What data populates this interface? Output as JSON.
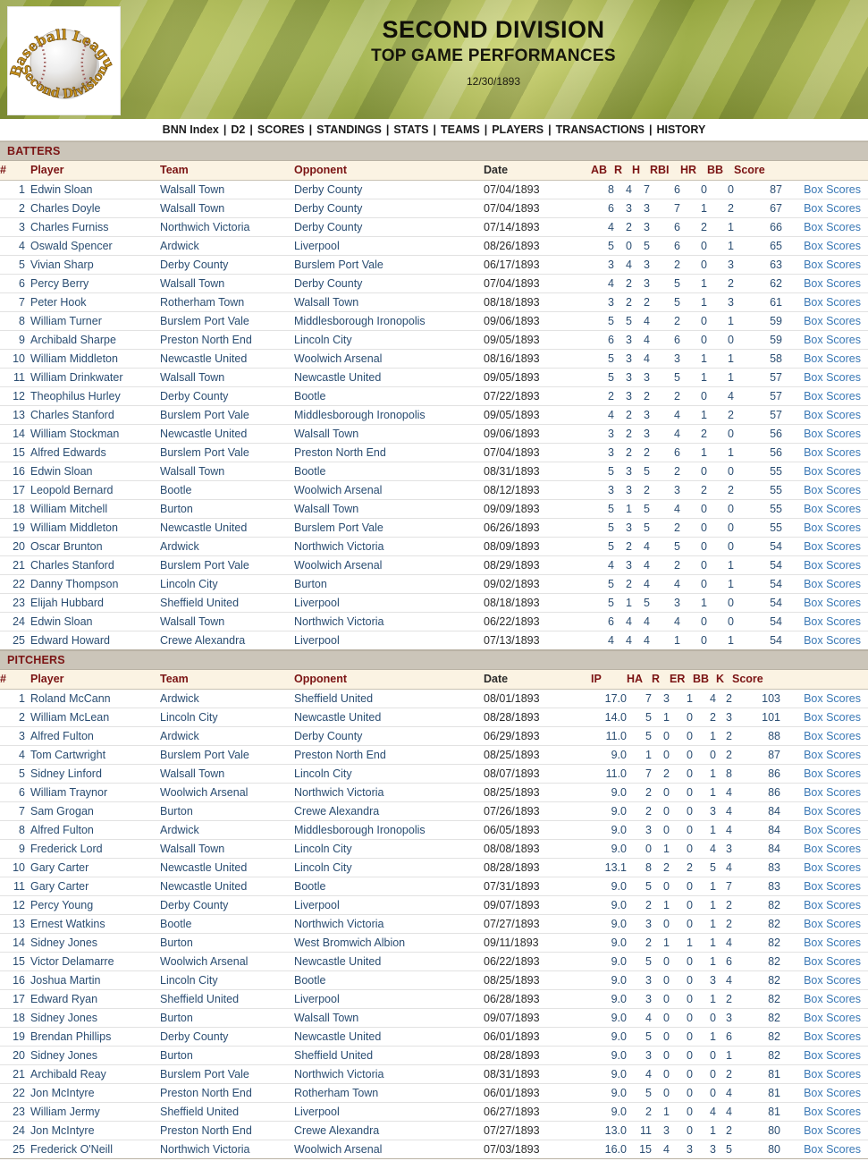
{
  "header": {
    "logo": {
      "top_text": "Baseball League",
      "bottom_text": "Second Division",
      "icon": "baseball-icon"
    },
    "title_main": "SECOND DIVISION",
    "title_sub": "TOP GAME PERFORMANCES",
    "date": "12/30/1893"
  },
  "nav": {
    "separator": "|",
    "items": [
      "BNN Index",
      "D2",
      "SCORES",
      "STANDINGS",
      "STATS",
      "TEAMS",
      "PLAYERS",
      "TRANSACTIONS",
      "HISTORY"
    ]
  },
  "colors": {
    "section_header_bg": "#cbc5b9",
    "section_header_text": "#7b1414",
    "column_header_bg": "#fbf3e3",
    "link": "#2a4d72",
    "box_link": "#3a78b5",
    "banner_green": "#a9b84a"
  },
  "batters": {
    "section_label": "BATTERS",
    "columns": [
      "#",
      "Player",
      "Team",
      "Opponent",
      "Date",
      "AB",
      "R",
      "H",
      "RBI",
      "HR",
      "BB",
      "Score",
      ""
    ],
    "box_label": "Box Scores",
    "rows": [
      {
        "rank": "1",
        "player": "Edwin Sloan",
        "team": "Walsall Town",
        "opponent": "Derby County",
        "date": "07/04/1893",
        "ab": "8",
        "r": "4",
        "h": "7",
        "rbi": "6",
        "hr": "0",
        "bb": "0",
        "score": "87"
      },
      {
        "rank": "2",
        "player": "Charles Doyle",
        "team": "Walsall Town",
        "opponent": "Derby County",
        "date": "07/04/1893",
        "ab": "6",
        "r": "3",
        "h": "3",
        "rbi": "7",
        "hr": "1",
        "bb": "2",
        "score": "67"
      },
      {
        "rank": "3",
        "player": "Charles Furniss",
        "team": "Northwich Victoria",
        "opponent": "Derby County",
        "date": "07/14/1893",
        "ab": "4",
        "r": "2",
        "h": "3",
        "rbi": "6",
        "hr": "2",
        "bb": "1",
        "score": "66"
      },
      {
        "rank": "4",
        "player": "Oswald Spencer",
        "team": "Ardwick",
        "opponent": "Liverpool",
        "date": "08/26/1893",
        "ab": "5",
        "r": "0",
        "h": "5",
        "rbi": "6",
        "hr": "0",
        "bb": "1",
        "score": "65"
      },
      {
        "rank": "5",
        "player": "Vivian Sharp",
        "team": "Derby County",
        "opponent": "Burslem Port Vale",
        "date": "06/17/1893",
        "ab": "3",
        "r": "4",
        "h": "3",
        "rbi": "2",
        "hr": "0",
        "bb": "3",
        "score": "63"
      },
      {
        "rank": "6",
        "player": "Percy Berry",
        "team": "Walsall Town",
        "opponent": "Derby County",
        "date": "07/04/1893",
        "ab": "4",
        "r": "2",
        "h": "3",
        "rbi": "5",
        "hr": "1",
        "bb": "2",
        "score": "62"
      },
      {
        "rank": "7",
        "player": "Peter Hook",
        "team": "Rotherham Town",
        "opponent": "Walsall Town",
        "date": "08/18/1893",
        "ab": "3",
        "r": "2",
        "h": "2",
        "rbi": "5",
        "hr": "1",
        "bb": "3",
        "score": "61"
      },
      {
        "rank": "8",
        "player": "William Turner",
        "team": "Burslem Port Vale",
        "opponent": "Middlesborough Ironopolis",
        "date": "09/06/1893",
        "ab": "5",
        "r": "5",
        "h": "4",
        "rbi": "2",
        "hr": "0",
        "bb": "1",
        "score": "59"
      },
      {
        "rank": "9",
        "player": "Archibald Sharpe",
        "team": "Preston North End",
        "opponent": "Lincoln City",
        "date": "09/05/1893",
        "ab": "6",
        "r": "3",
        "h": "4",
        "rbi": "6",
        "hr": "0",
        "bb": "0",
        "score": "59"
      },
      {
        "rank": "10",
        "player": "William Middleton",
        "team": "Newcastle United",
        "opponent": "Woolwich Arsenal",
        "date": "08/16/1893",
        "ab": "5",
        "r": "3",
        "h": "4",
        "rbi": "3",
        "hr": "1",
        "bb": "1",
        "score": "58"
      },
      {
        "rank": "11",
        "player": "William Drinkwater",
        "team": "Walsall Town",
        "opponent": "Newcastle United",
        "date": "09/05/1893",
        "ab": "5",
        "r": "3",
        "h": "3",
        "rbi": "5",
        "hr": "1",
        "bb": "1",
        "score": "57"
      },
      {
        "rank": "12",
        "player": "Theophilus Hurley",
        "team": "Derby County",
        "opponent": "Bootle",
        "date": "07/22/1893",
        "ab": "2",
        "r": "3",
        "h": "2",
        "rbi": "2",
        "hr": "0",
        "bb": "4",
        "score": "57"
      },
      {
        "rank": "13",
        "player": "Charles Stanford",
        "team": "Burslem Port Vale",
        "opponent": "Middlesborough Ironopolis",
        "date": "09/05/1893",
        "ab": "4",
        "r": "2",
        "h": "3",
        "rbi": "4",
        "hr": "1",
        "bb": "2",
        "score": "57"
      },
      {
        "rank": "14",
        "player": "William Stockman",
        "team": "Newcastle United",
        "opponent": "Walsall Town",
        "date": "09/06/1893",
        "ab": "3",
        "r": "2",
        "h": "3",
        "rbi": "4",
        "hr": "2",
        "bb": "0",
        "score": "56"
      },
      {
        "rank": "15",
        "player": "Alfred Edwards",
        "team": "Burslem Port Vale",
        "opponent": "Preston North End",
        "date": "07/04/1893",
        "ab": "3",
        "r": "2",
        "h": "2",
        "rbi": "6",
        "hr": "1",
        "bb": "1",
        "score": "56"
      },
      {
        "rank": "16",
        "player": "Edwin Sloan",
        "team": "Walsall Town",
        "opponent": "Bootle",
        "date": "08/31/1893",
        "ab": "5",
        "r": "3",
        "h": "5",
        "rbi": "2",
        "hr": "0",
        "bb": "0",
        "score": "55"
      },
      {
        "rank": "17",
        "player": "Leopold Bernard",
        "team": "Bootle",
        "opponent": "Woolwich Arsenal",
        "date": "08/12/1893",
        "ab": "3",
        "r": "3",
        "h": "2",
        "rbi": "3",
        "hr": "2",
        "bb": "2",
        "score": "55"
      },
      {
        "rank": "18",
        "player": "William Mitchell",
        "team": "Burton",
        "opponent": "Walsall Town",
        "date": "09/09/1893",
        "ab": "5",
        "r": "1",
        "h": "5",
        "rbi": "4",
        "hr": "0",
        "bb": "0",
        "score": "55"
      },
      {
        "rank": "19",
        "player": "William Middleton",
        "team": "Newcastle United",
        "opponent": "Burslem Port Vale",
        "date": "06/26/1893",
        "ab": "5",
        "r": "3",
        "h": "5",
        "rbi": "2",
        "hr": "0",
        "bb": "0",
        "score": "55"
      },
      {
        "rank": "20",
        "player": "Oscar Brunton",
        "team": "Ardwick",
        "opponent": "Northwich Victoria",
        "date": "08/09/1893",
        "ab": "5",
        "r": "2",
        "h": "4",
        "rbi": "5",
        "hr": "0",
        "bb": "0",
        "score": "54"
      },
      {
        "rank": "21",
        "player": "Charles Stanford",
        "team": "Burslem Port Vale",
        "opponent": "Woolwich Arsenal",
        "date": "08/29/1893",
        "ab": "4",
        "r": "3",
        "h": "4",
        "rbi": "2",
        "hr": "0",
        "bb": "1",
        "score": "54"
      },
      {
        "rank": "22",
        "player": "Danny Thompson",
        "team": "Lincoln City",
        "opponent": "Burton",
        "date": "09/02/1893",
        "ab": "5",
        "r": "2",
        "h": "4",
        "rbi": "4",
        "hr": "0",
        "bb": "1",
        "score": "54"
      },
      {
        "rank": "23",
        "player": "Elijah Hubbard",
        "team": "Sheffield United",
        "opponent": "Liverpool",
        "date": "08/18/1893",
        "ab": "5",
        "r": "1",
        "h": "5",
        "rbi": "3",
        "hr": "1",
        "bb": "0",
        "score": "54"
      },
      {
        "rank": "24",
        "player": "Edwin Sloan",
        "team": "Walsall Town",
        "opponent": "Northwich Victoria",
        "date": "06/22/1893",
        "ab": "6",
        "r": "4",
        "h": "4",
        "rbi": "4",
        "hr": "0",
        "bb": "0",
        "score": "54"
      },
      {
        "rank": "25",
        "player": "Edward Howard",
        "team": "Crewe Alexandra",
        "opponent": "Liverpool",
        "date": "07/13/1893",
        "ab": "4",
        "r": "4",
        "h": "4",
        "rbi": "1",
        "hr": "0",
        "bb": "1",
        "score": "54"
      }
    ]
  },
  "pitchers": {
    "section_label": "PITCHERS",
    "columns": [
      "#",
      "Player",
      "Team",
      "Opponent",
      "Date",
      "IP",
      "HA",
      "R",
      "ER",
      "BB",
      "K",
      "Score",
      ""
    ],
    "box_label": "Box Scores",
    "rows": [
      {
        "rank": "1",
        "player": "Roland McCann",
        "team": "Ardwick",
        "opponent": "Sheffield United",
        "date": "08/01/1893",
        "ip": "17.0",
        "ha": "7",
        "r": "3",
        "er": "1",
        "bb": "4",
        "k": "2",
        "score": "103"
      },
      {
        "rank": "2",
        "player": "William McLean",
        "team": "Lincoln City",
        "opponent": "Newcastle United",
        "date": "08/28/1893",
        "ip": "14.0",
        "ha": "5",
        "r": "1",
        "er": "0",
        "bb": "2",
        "k": "3",
        "score": "101"
      },
      {
        "rank": "3",
        "player": "Alfred Fulton",
        "team": "Ardwick",
        "opponent": "Derby County",
        "date": "06/29/1893",
        "ip": "11.0",
        "ha": "5",
        "r": "0",
        "er": "0",
        "bb": "1",
        "k": "2",
        "score": "88"
      },
      {
        "rank": "4",
        "player": "Tom Cartwright",
        "team": "Burslem Port Vale",
        "opponent": "Preston North End",
        "date": "08/25/1893",
        "ip": "9.0",
        "ha": "1",
        "r": "0",
        "er": "0",
        "bb": "0",
        "k": "2",
        "score": "87"
      },
      {
        "rank": "5",
        "player": "Sidney Linford",
        "team": "Walsall Town",
        "opponent": "Lincoln City",
        "date": "08/07/1893",
        "ip": "11.0",
        "ha": "7",
        "r": "2",
        "er": "0",
        "bb": "1",
        "k": "8",
        "score": "86"
      },
      {
        "rank": "6",
        "player": "William Traynor",
        "team": "Woolwich Arsenal",
        "opponent": "Northwich Victoria",
        "date": "08/25/1893",
        "ip": "9.0",
        "ha": "2",
        "r": "0",
        "er": "0",
        "bb": "1",
        "k": "4",
        "score": "86"
      },
      {
        "rank": "7",
        "player": "Sam Grogan",
        "team": "Burton",
        "opponent": "Crewe Alexandra",
        "date": "07/26/1893",
        "ip": "9.0",
        "ha": "2",
        "r": "0",
        "er": "0",
        "bb": "3",
        "k": "4",
        "score": "84"
      },
      {
        "rank": "8",
        "player": "Alfred Fulton",
        "team": "Ardwick",
        "opponent": "Middlesborough Ironopolis",
        "date": "06/05/1893",
        "ip": "9.0",
        "ha": "3",
        "r": "0",
        "er": "0",
        "bb": "1",
        "k": "4",
        "score": "84"
      },
      {
        "rank": "9",
        "player": "Frederick Lord",
        "team": "Walsall Town",
        "opponent": "Lincoln City",
        "date": "08/08/1893",
        "ip": "9.0",
        "ha": "0",
        "r": "1",
        "er": "0",
        "bb": "4",
        "k": "3",
        "score": "84"
      },
      {
        "rank": "10",
        "player": "Gary Carter",
        "team": "Newcastle United",
        "opponent": "Lincoln City",
        "date": "08/28/1893",
        "ip": "13.1",
        "ha": "8",
        "r": "2",
        "er": "2",
        "bb": "5",
        "k": "4",
        "score": "83"
      },
      {
        "rank": "11",
        "player": "Gary Carter",
        "team": "Newcastle United",
        "opponent": "Bootle",
        "date": "07/31/1893",
        "ip": "9.0",
        "ha": "5",
        "r": "0",
        "er": "0",
        "bb": "1",
        "k": "7",
        "score": "83"
      },
      {
        "rank": "12",
        "player": "Percy Young",
        "team": "Derby County",
        "opponent": "Liverpool",
        "date": "09/07/1893",
        "ip": "9.0",
        "ha": "2",
        "r": "1",
        "er": "0",
        "bb": "1",
        "k": "2",
        "score": "82"
      },
      {
        "rank": "13",
        "player": "Ernest Watkins",
        "team": "Bootle",
        "opponent": "Northwich Victoria",
        "date": "07/27/1893",
        "ip": "9.0",
        "ha": "3",
        "r": "0",
        "er": "0",
        "bb": "1",
        "k": "2",
        "score": "82"
      },
      {
        "rank": "14",
        "player": "Sidney Jones",
        "team": "Burton",
        "opponent": "West Bromwich Albion",
        "date": "09/11/1893",
        "ip": "9.0",
        "ha": "2",
        "r": "1",
        "er": "1",
        "bb": "1",
        "k": "4",
        "score": "82"
      },
      {
        "rank": "15",
        "player": "Victor Delamarre",
        "team": "Woolwich Arsenal",
        "opponent": "Newcastle United",
        "date": "06/22/1893",
        "ip": "9.0",
        "ha": "5",
        "r": "0",
        "er": "0",
        "bb": "1",
        "k": "6",
        "score": "82"
      },
      {
        "rank": "16",
        "player": "Joshua Martin",
        "team": "Lincoln City",
        "opponent": "Bootle",
        "date": "08/25/1893",
        "ip": "9.0",
        "ha": "3",
        "r": "0",
        "er": "0",
        "bb": "3",
        "k": "4",
        "score": "82"
      },
      {
        "rank": "17",
        "player": "Edward Ryan",
        "team": "Sheffield United",
        "opponent": "Liverpool",
        "date": "06/28/1893",
        "ip": "9.0",
        "ha": "3",
        "r": "0",
        "er": "0",
        "bb": "1",
        "k": "2",
        "score": "82"
      },
      {
        "rank": "18",
        "player": "Sidney Jones",
        "team": "Burton",
        "opponent": "Walsall Town",
        "date": "09/07/1893",
        "ip": "9.0",
        "ha": "4",
        "r": "0",
        "er": "0",
        "bb": "0",
        "k": "3",
        "score": "82"
      },
      {
        "rank": "19",
        "player": "Brendan Phillips",
        "team": "Derby County",
        "opponent": "Newcastle United",
        "date": "06/01/1893",
        "ip": "9.0",
        "ha": "5",
        "r": "0",
        "er": "0",
        "bb": "1",
        "k": "6",
        "score": "82"
      },
      {
        "rank": "20",
        "player": "Sidney Jones",
        "team": "Burton",
        "opponent": "Sheffield United",
        "date": "08/28/1893",
        "ip": "9.0",
        "ha": "3",
        "r": "0",
        "er": "0",
        "bb": "0",
        "k": "1",
        "score": "82"
      },
      {
        "rank": "21",
        "player": "Archibald Reay",
        "team": "Burslem Port Vale",
        "opponent": "Northwich Victoria",
        "date": "08/31/1893",
        "ip": "9.0",
        "ha": "4",
        "r": "0",
        "er": "0",
        "bb": "0",
        "k": "2",
        "score": "81"
      },
      {
        "rank": "22",
        "player": "Jon McIntyre",
        "team": "Preston North End",
        "opponent": "Rotherham Town",
        "date": "06/01/1893",
        "ip": "9.0",
        "ha": "5",
        "r": "0",
        "er": "0",
        "bb": "0",
        "k": "4",
        "score": "81"
      },
      {
        "rank": "23",
        "player": "William Jermy",
        "team": "Sheffield United",
        "opponent": "Liverpool",
        "date": "06/27/1893",
        "ip": "9.0",
        "ha": "2",
        "r": "1",
        "er": "0",
        "bb": "4",
        "k": "4",
        "score": "81"
      },
      {
        "rank": "24",
        "player": "Jon McIntyre",
        "team": "Preston North End",
        "opponent": "Crewe Alexandra",
        "date": "07/27/1893",
        "ip": "13.0",
        "ha": "11",
        "r": "3",
        "er": "0",
        "bb": "1",
        "k": "2",
        "score": "80"
      },
      {
        "rank": "25",
        "player": "Frederick O'Neill",
        "team": "Northwich Victoria",
        "opponent": "Woolwich Arsenal",
        "date": "07/03/1893",
        "ip": "16.0",
        "ha": "15",
        "r": "4",
        "er": "3",
        "bb": "3",
        "k": "5",
        "score": "80"
      }
    ]
  }
}
